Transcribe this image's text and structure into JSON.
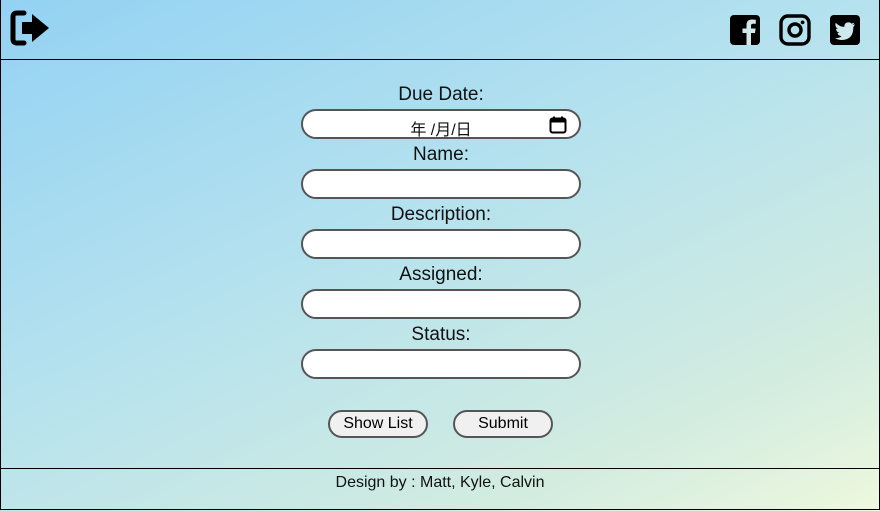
{
  "header": {
    "icons": [
      "logout-icon",
      "facebook-icon",
      "instagram-icon",
      "twitter-icon"
    ]
  },
  "form": {
    "due_date_label": "Due Date:",
    "due_date_value": "年 /月/日",
    "name_label": "Name:",
    "name_value": "",
    "description_label": "Description:",
    "description_value": "",
    "assigned_label": "Assigned:",
    "assigned_value": "",
    "status_label": "Status:",
    "status_value": ""
  },
  "buttons": {
    "show_list": "Show List",
    "submit": "Submit"
  },
  "footer": {
    "credit": "Design by : Matt, Kyle, Calvin"
  }
}
